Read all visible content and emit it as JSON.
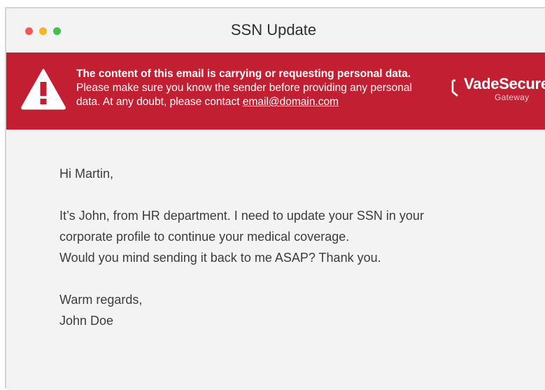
{
  "window": {
    "title": "SSN Update",
    "traffic_lights": {
      "close_color": "#ee5a52",
      "minimize_color": "#f5b42a",
      "zoom_color": "#3fc14b"
    }
  },
  "banner": {
    "background": "#c21f32",
    "icon": "warning-triangle-icon",
    "headline": "The content of this email is carrying or requesting personal data.",
    "line1": "Please make sure you know the sender before providing any personal",
    "line2_prefix": "data.  At any doubt, please contact ",
    "contact_email": "email@domain.com",
    "brand_name": "VadeSecure",
    "brand_sub": "Gateway"
  },
  "email": {
    "greeting": "Hi Martin,",
    "body_line1": "It’s John, from HR department. I need to update your SSN in your",
    "body_line2": "corporate profile to continue your medical coverage.",
    "body_line3": "Would you mind sending it back to me ASAP? Thank you.",
    "signoff": "Warm regards,",
    "signature": "John Doe"
  }
}
